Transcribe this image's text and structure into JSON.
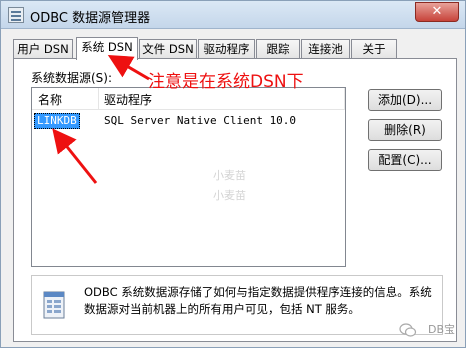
{
  "window": {
    "title": "ODBC 数据源管理器",
    "close_glyph": "✕"
  },
  "tabs": [
    {
      "label": "用户 DSN"
    },
    {
      "label": "系统 DSN"
    },
    {
      "label": "文件 DSN"
    },
    {
      "label": "驱动程序"
    },
    {
      "label": "跟踪"
    },
    {
      "label": "连接池"
    },
    {
      "label": "关于"
    }
  ],
  "panel": {
    "section_label": "系统数据源(S):",
    "columns": {
      "name": "名称",
      "driver": "驱动程序"
    },
    "rows": [
      {
        "name": "LINKDB",
        "driver": "SQL Server Native Client 10.0"
      }
    ],
    "buttons": {
      "add": "添加(D)...",
      "remove": "删除(R)",
      "configure": "配置(C)..."
    },
    "info_text": "ODBC 系统数据源存储了如何与指定数据提供程序连接的信息。系统数据源对当前机器上的所有用户可见，包括 NT 服务。"
  },
  "annotation": {
    "text": "注意是在系统DSN下",
    "color": "#ee1111"
  },
  "watermarks": [
    "小麦苗",
    "小麦苗"
  ],
  "brand": "DB宝",
  "icons": [
    "odbc-app-icon",
    "close-icon",
    "odbc-info-icon",
    "wechat-logo-icon"
  ]
}
